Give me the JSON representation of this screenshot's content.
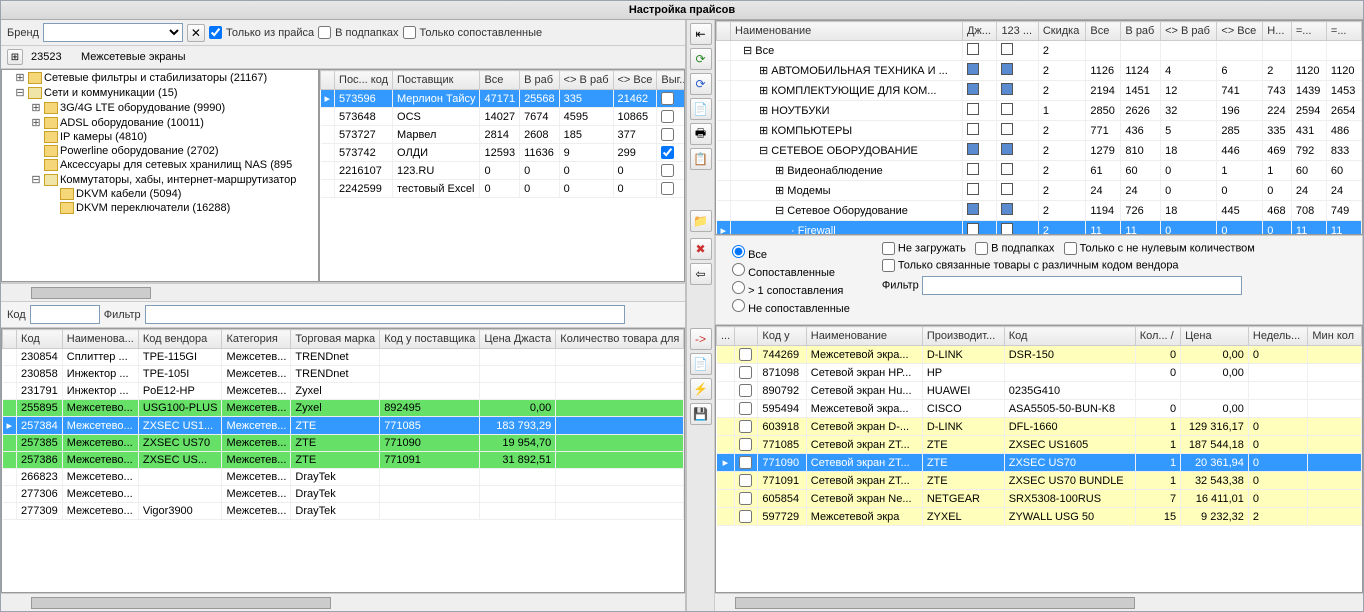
{
  "title": "Настройка прайсов",
  "brand_label": "Бренд",
  "chk_only_price": "Только из прайса",
  "chk_subfold": "В подпапках",
  "chk_only_mapped": "Только сопоставленные",
  "breadcrumb_code": "23523",
  "breadcrumb_name": "Межсетевые экраны",
  "tree": [
    {
      "lvl": 1,
      "exp": "+",
      "label": "Сетевые фильтры и стабилизаторы (21167)"
    },
    {
      "lvl": 1,
      "exp": "-",
      "label": "Сети и коммуникации (15)",
      "open": true
    },
    {
      "lvl": 2,
      "exp": "+",
      "label": "3G/4G LTE оборудование (9990)"
    },
    {
      "lvl": 2,
      "exp": "+",
      "label": "ADSL оборудование (10011)"
    },
    {
      "lvl": 2,
      "exp": "",
      "label": "IP камеры (4810)"
    },
    {
      "lvl": 2,
      "exp": "",
      "label": "Powerline оборудование (2702)"
    },
    {
      "lvl": 2,
      "exp": "",
      "label": "Аксессуары для сетевых хранилищ NAS (895"
    },
    {
      "lvl": 2,
      "exp": "-",
      "label": "Коммутаторы, хабы, интернет-маршрутизатор",
      "open": true
    },
    {
      "lvl": 3,
      "exp": "",
      "label": "DKVM кабели (5094)"
    },
    {
      "lvl": 3,
      "exp": "",
      "label": "DKVM переключатели (16288)"
    }
  ],
  "sup_cols": [
    "Пос... код",
    "Поставщик",
    "Все",
    "В раб",
    "<> В раб",
    "<> Все",
    "Выг... в"
  ],
  "suppliers": [
    {
      "sel": true,
      "code": "573596",
      "name": "Мерлион Тайсу",
      "all": "47171",
      "wrk": "25568",
      "d1": "335",
      "d2": "21462",
      "chk": false
    },
    {
      "code": "573648",
      "name": "OCS",
      "all": "14027",
      "wrk": "7674",
      "d1": "4595",
      "d2": "10865",
      "chk": false
    },
    {
      "code": "573727",
      "name": "Марвел",
      "all": "2814",
      "wrk": "2608",
      "d1": "185",
      "d2": "377",
      "chk": false
    },
    {
      "code": "573742",
      "name": "ОЛДИ",
      "all": "12593",
      "wrk": "11636",
      "d1": "9",
      "d2": "299",
      "chk": true
    },
    {
      "code": "2216107",
      "name": "123.RU",
      "all": "0",
      "wrk": "0",
      "d1": "0",
      "d2": "0",
      "chk": false
    },
    {
      "code": "2242599",
      "name": "тестовый Excel",
      "all": "0",
      "wrk": "0",
      "d1": "0",
      "d2": "0",
      "chk": false
    }
  ],
  "code_label": "Код",
  "filter_label": "Фильтр",
  "prod_cols": [
    "",
    "Код",
    "Наименова...",
    "Код вендора",
    "Категория",
    "Торговая марка",
    "Код у поставщика",
    "Цена Джаста",
    "Количество товара для"
  ],
  "products": [
    {
      "code": "230854",
      "name": "Сплиттер ...",
      "ven": "TPE-115GI",
      "cat": "Межсетев...",
      "mark": "TRENDnet",
      "sup": "",
      "price": "",
      "qty": ""
    },
    {
      "code": "230858",
      "name": "Инжектор ...",
      "ven": "TPE-105I",
      "cat": "Межсетев...",
      "mark": "TRENDnet",
      "sup": "",
      "price": "",
      "qty": ""
    },
    {
      "code": "231791",
      "name": "Инжектор ...",
      "ven": "PoE12-HP",
      "cat": "Межсетев...",
      "mark": "Zyxel",
      "sup": "",
      "price": "",
      "qty": ""
    },
    {
      "cls": "green",
      "code": "255895",
      "name": "Межсетево...",
      "ven": "USG100-PLUS",
      "cat": "Межсетев...",
      "mark": "Zyxel",
      "sup": "892495",
      "price": "0,00",
      "qty": ""
    },
    {
      "cls": "sel",
      "code": "257384",
      "name": "Межсетево...",
      "ven": "ZXSEC US1...",
      "cat": "Межсетев...",
      "mark": "ZTE",
      "sup": "771085",
      "price": "183 793,29",
      "qty": "",
      "supblue": true
    },
    {
      "cls": "green",
      "code": "257385",
      "name": "Межсетево...",
      "ven": "ZXSEC US70",
      "cat": "Межсетев...",
      "mark": "ZTE",
      "sup": "771090",
      "price": "19 954,70",
      "qty": ""
    },
    {
      "cls": "green",
      "code": "257386",
      "name": "Межсетево...",
      "ven": "ZXSEC US...",
      "cat": "Межсетев...",
      "mark": "ZTE",
      "sup": "771091",
      "price": "31 892,51",
      "qty": ""
    },
    {
      "code": "266823",
      "name": "Межсетево...",
      "ven": "",
      "cat": "Межсетев...",
      "mark": "DrayTek",
      "sup": "",
      "price": "",
      "qty": ""
    },
    {
      "code": "277306",
      "name": "Межсетево...",
      "ven": "",
      "cat": "Межсетев...",
      "mark": "DrayTek",
      "sup": "",
      "price": "",
      "qty": ""
    },
    {
      "code": "277309",
      "name": "Межсетево...",
      "ven": "Vigor3900",
      "cat": "Межсетев...",
      "mark": "DrayTek",
      "sup": "",
      "price": "",
      "qty": ""
    }
  ],
  "rt_cols": [
    "Наименование",
    "Дж...",
    "123 ...",
    "Скидка",
    "Все",
    "В раб",
    "<> В раб",
    "<> Все",
    "Н...",
    "=...",
    "=..."
  ],
  "rt_rows": [
    {
      "lvl": 0,
      "exp": "-",
      "name": "Все",
      "c1": false,
      "c2": false,
      "sk": "2"
    },
    {
      "lvl": 1,
      "exp": "+",
      "name": "АВТОМОБИЛЬНАЯ ТЕХНИКА И ...",
      "c1": true,
      "c2": true,
      "sk": "2",
      "v": [
        "1126",
        "1124",
        "4",
        "6",
        "2",
        "1120",
        "1120"
      ]
    },
    {
      "lvl": 1,
      "exp": "+",
      "name": "КОМПЛЕКТУЮЩИЕ ДЛЯ КОМ...",
      "c1": true,
      "c2": true,
      "sk": "2",
      "v": [
        "2194",
        "1451",
        "12",
        "741",
        "743",
        "1439",
        "1453"
      ]
    },
    {
      "lvl": 1,
      "exp": "+",
      "name": "НОУТБУКИ",
      "c1": false,
      "c2": false,
      "sk": "1",
      "v": [
        "2850",
        "2626",
        "32",
        "196",
        "224",
        "2594",
        "2654"
      ]
    },
    {
      "lvl": 1,
      "exp": "+",
      "name": "КОМПЬЮТЕРЫ",
      "c1": false,
      "c2": false,
      "sk": "2",
      "v": [
        "771",
        "436",
        "5",
        "285",
        "335",
        "431",
        "486"
      ]
    },
    {
      "lvl": 1,
      "exp": "-",
      "name": "СЕТЕВОЕ ОБОРУДОВАНИЕ",
      "c1": true,
      "c2": true,
      "sk": "2",
      "v": [
        "1279",
        "810",
        "18",
        "446",
        "469",
        "792",
        "833"
      ]
    },
    {
      "lvl": 2,
      "exp": "+",
      "name": "Видеонаблюдение",
      "c1": false,
      "c2": false,
      "sk": "2",
      "v": [
        "61",
        "60",
        "0",
        "1",
        "1",
        "60",
        "60"
      ]
    },
    {
      "lvl": 2,
      "exp": "+",
      "name": "Модемы",
      "c1": false,
      "c2": false,
      "sk": "2",
      "v": [
        "24",
        "24",
        "0",
        "0",
        "0",
        "24",
        "24"
      ]
    },
    {
      "lvl": 2,
      "exp": "-",
      "name": "Сетевое Оборудование",
      "c1": true,
      "c2": true,
      "sk": "2",
      "v": [
        "1194",
        "726",
        "18",
        "445",
        "468",
        "708",
        "749"
      ]
    },
    {
      "lvl": 3,
      "exp": "",
      "name": "Firewall",
      "c1": false,
      "c2": false,
      "sk": "2",
      "v": [
        "11",
        "11",
        "0",
        "0",
        "0",
        "11",
        "11"
      ],
      "sel": true
    }
  ],
  "rfilter": {
    "r_all": "Все",
    "r_mapped": "Сопоставленные",
    "r_multi": "> 1 сопоставления",
    "r_none": "Не сопоставленные",
    "chk_noload": "Не загружать",
    "chk_sub": "В подпапках",
    "chk_nonzero": "Только с не нулевым количеством",
    "chk_diffven": "Только связанные товары с различным кодом вендора",
    "filter": "Фильтр"
  },
  "rb_cols": [
    "...",
    "",
    "Код у",
    "Наименование",
    "Производит...",
    "Код",
    "Кол... /",
    "Цена",
    "Недель...",
    "Мин кол"
  ],
  "rb_rows": [
    {
      "cls": "yellow",
      "code": "744269",
      "name": "Межсетевой экра...",
      "man": "D-LINK",
      "kod": "DSR-150",
      "qty": "0",
      "price": "0,00",
      "wk": "0"
    },
    {
      "code": "871098",
      "name": "Сетевой экран HP...",
      "man": "HP",
      "kod": "",
      "qty": "0",
      "price": "0,00",
      "wk": ""
    },
    {
      "code": "890792",
      "name": "Сетевой экран Hu...",
      "man": "HUAWEI",
      "kod": "0235G410",
      "qty": "",
      "price": "",
      "wk": ""
    },
    {
      "code": "595494",
      "name": "Межсетевой экра...",
      "man": "CISCO",
      "kod": "ASA5505-50-BUN-K8",
      "qty": "0",
      "price": "0,00",
      "wk": ""
    },
    {
      "cls": "yellow",
      "code": "603918",
      "name": "Сетевой экран D-...",
      "man": "D-LINK",
      "kod": "DFL-1660",
      "qty": "1",
      "price": "129 316,17",
      "wk": "0"
    },
    {
      "cls": "yellow",
      "code": "771085",
      "name": "Сетевой экран ZT...",
      "man": "ZTE",
      "kod": "ZXSEC US1605",
      "qty": "1",
      "price": "187 544,18",
      "wk": "0"
    },
    {
      "cls": "sel",
      "ptr": true,
      "code": "771090",
      "name": "Сетевой экран ZT...",
      "man": "ZTE",
      "kod": "ZXSEC US70",
      "qty": "1",
      "price": "20 361,94",
      "wk": "0"
    },
    {
      "cls": "yellow",
      "code": "771091",
      "name": "Сетевой экран ZT...",
      "man": "ZTE",
      "kod": "ZXSEC US70 BUNDLE",
      "qty": "1",
      "price": "32 543,38",
      "wk": "0"
    },
    {
      "cls": "yellow",
      "code": "605854",
      "name": "Сетевой экран Ne...",
      "man": "NETGEAR",
      "kod": "SRX5308-100RUS",
      "qty": "7",
      "price": "16 411,01",
      "wk": "0"
    },
    {
      "cls": "yellow",
      "code": "597729",
      "name": "Межсетевой экра",
      "man": "ZYXEL",
      "kod": "ZYWALL USG 50",
      "qty": "15",
      "price": "9 232,32",
      "wk": "2"
    }
  ]
}
